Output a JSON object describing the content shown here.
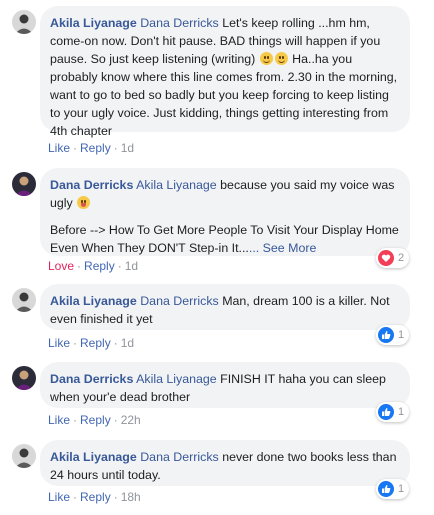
{
  "comments": [
    {
      "author": "Akila Liyanage",
      "tag": "Dana Derricks",
      "text": "Let's keep rolling ...hm hm, come-on now. Don't hit pause. BAD things will happen if you pause. So just keep listening (writing)",
      "text_after": "Ha..ha you probably know where this line comes from. 2.30 in the morning, want to go to bed so badly but you keep forcing to keep listing to your ugly voice. Just kidding, things getting interesting from 4th chapter",
      "actions": {
        "like": "Like",
        "reply": "Reply",
        "time": "1d"
      }
    },
    {
      "author": "Dana Derricks",
      "tag": "Akila Liyanage",
      "text": "because you said my voice was ugly",
      "text2": "Before --> How To Get More People To Visit Your Display Home Even When They DON'T Step-in It...",
      "see_more": "... See More",
      "actions": {
        "like": "Love",
        "reply": "Reply",
        "time": "1d"
      },
      "reaction": {
        "icon": "heart-icon",
        "count": "2",
        "color": "#f33e58"
      }
    },
    {
      "author": "Akila Liyanage",
      "tag": "Dana Derricks",
      "text": "Man, dream 100 is a killer. Not even finished it yet",
      "actions": {
        "like": "Like",
        "reply": "Reply",
        "time": "1d"
      },
      "reaction": {
        "icon": "thumbs-up-icon",
        "count": "1",
        "color": "#1877f2"
      }
    },
    {
      "author": "Dana Derricks",
      "tag": "Akila Liyanage",
      "text": "FINISH IT haha you can sleep when your'e dead brother",
      "actions": {
        "like": "Like",
        "reply": "Reply",
        "time": "22h"
      },
      "reaction": {
        "icon": "thumbs-up-icon",
        "count": "1",
        "color": "#1877f2"
      }
    },
    {
      "author": "Akila Liyanage",
      "tag": "Dana Derricks",
      "text": "never done two books less than 24 hours until today.",
      "actions": {
        "like": "Like",
        "reply": "Reply",
        "time": "18h"
      },
      "reaction": {
        "icon": "thumbs-up-icon",
        "count": "1",
        "color": "#1877f2"
      }
    }
  ]
}
